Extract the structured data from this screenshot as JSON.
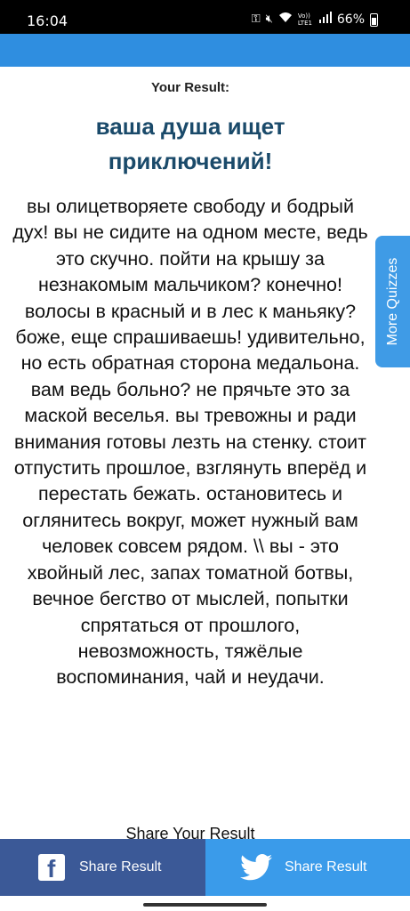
{
  "status_bar": {
    "time": "16:04",
    "network_label": "Vo)) LTE1",
    "battery": "66%",
    "icons": [
      "key-icon",
      "mute-icon",
      "wifi-icon",
      "signal-icon",
      "battery-icon"
    ]
  },
  "header": {
    "color": "#2f8ee0"
  },
  "result": {
    "label": "Your Result:",
    "title": "ваша душа ищет приключений!",
    "description": "вы олицетворяете свободу и бодрый дух! вы не сидите на одном месте, ведь это скучно. пойти на крышу за незнакомым мальчиком? конечно! волосы в красный и в лес к маньяку? боже, еще спрашиваешь! удивительно, но есть обратная сторона медальона. вам ведь больно? не прячьте это за маской веселья. вы тревожны и ради внимания готовы лезть на стенку. стоит отпустить прошлое, взглянуть вперёд и перестать бежать. остановитесь и оглянитесь вокруг, может нужный вам человек совсем рядом. \\\\ вы - это хвойный лес, запах томатной ботвы, вечное бегство от мыслей, попытки спрятаться от прошлого, невозможность, тяжёлые воспоминания, чай и неудачи.",
    "share_label": "Share Your Result"
  },
  "side_tab": {
    "label": "More Quizzes"
  },
  "share_bar": {
    "facebook_label": "Share Result",
    "twitter_label": "Share Result",
    "facebook_color": "#3b5997",
    "twitter_color": "#3a9bea"
  }
}
